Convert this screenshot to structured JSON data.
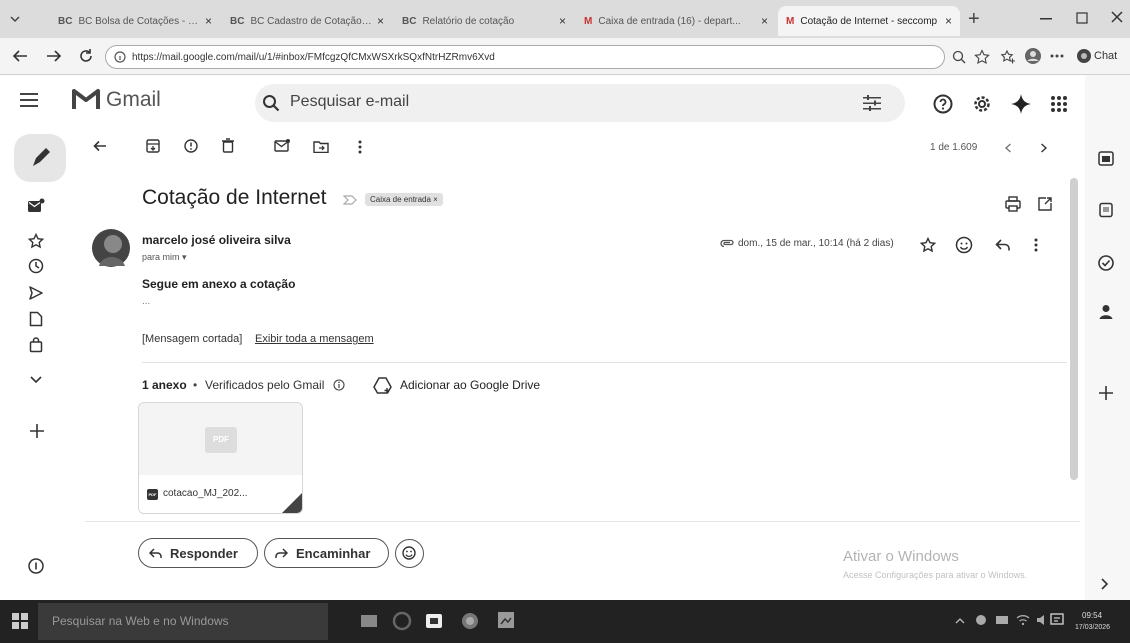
{
  "browser": {
    "tabs": [
      {
        "label": "BC Bolsa de Cotações - BNC",
        "favicon": "BC"
      },
      {
        "label": "BC Cadastro de Cotação - BNC",
        "favicon": "BC"
      },
      {
        "label": "Relatório de cotação",
        "favicon": "BC"
      },
      {
        "label": "Caixa de entrada (16) - depart...",
        "favicon": "M"
      },
      {
        "label": "Cotação de Internet - seccomp",
        "favicon": "M"
      }
    ],
    "close_glyph": "×",
    "new_tab_glyph": "+",
    "url": "https://mail.google.com/mail/u/1/#inbox/FMfcgzQfCMxWSXrkSQxfNtrHZRmv6Xvd",
    "copilot_label": "Chat"
  },
  "gmail": {
    "logo_text": "Gmail",
    "search_placeholder": "Pesquisar e-mail",
    "pagination": "1 de 1.609"
  },
  "email": {
    "subject": "Cotação de Internet",
    "label_chip": "Caixa de entrada ×",
    "sender_name": "marcelo josé oliveira silva",
    "to_line": "para mim ▾",
    "date": "dom., 15 de mar., 10:14 (há 2 dias)",
    "body_line": "Segue em anexo a cotação",
    "ellipsis": "...",
    "clipped_text": "[Mensagem cortada]",
    "clipped_link": "Exibir toda a mensagem",
    "attach_count": "1 anexo",
    "attach_bullet": "•",
    "attach_verified": "Verificados pelo Gmail",
    "add_drive": "Adicionar ao Google Drive",
    "attachment_file": "cotacao_MJ_202...",
    "pdf_badge": "PDF"
  },
  "actions": {
    "reply": "Responder",
    "forward": "Encaminhar"
  },
  "watermark": {
    "title": "Ativar o Windows",
    "subtitle": "Acesse Configurações para ativar o Windows."
  },
  "taskbar": {
    "search": "Pesquisar na Web e no Windows",
    "time": "09:54",
    "date": "17/03/2026"
  }
}
